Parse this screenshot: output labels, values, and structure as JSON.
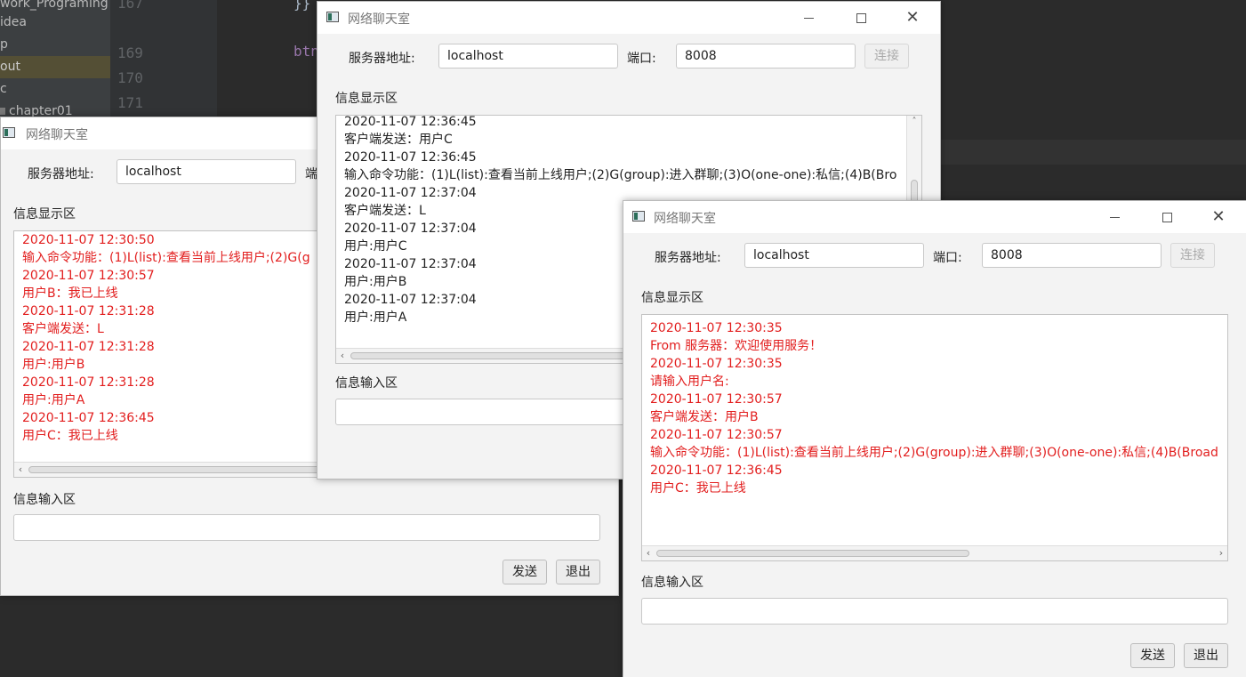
{
  "ide": {
    "tree_items": [
      "work_Programing",
      "idea",
      "p",
      "out",
      "c",
      "chapter01"
    ],
    "line_numbers": [
      "167",
      "169",
      "170",
      "171"
    ],
    "code_fragments": [
      "}}",
      "btn"
    ]
  },
  "win1": {
    "title": "网络聊天室",
    "server_label": "服务器地址:",
    "server_value": "localhost",
    "port_label_partial": "端",
    "log_label": "信息显示区",
    "log_lines": [
      "2020-11-07 12:30:50",
      "输入命令功能：(1)L(list):查看当前上线用户;(2)G(g",
      "2020-11-07 12:30:57",
      "用户B：我已上线",
      "2020-11-07 12:31:28",
      "客户端发送：L",
      "2020-11-07 12:31:28",
      "用户:用户B",
      "2020-11-07 12:31:28",
      "用户:用户A",
      "2020-11-07 12:36:45",
      "用户C：我已上线"
    ],
    "input_label": "信息输入区",
    "input_value": "",
    "send_label": "发送",
    "exit_label": "退出"
  },
  "win2": {
    "title": "网络聊天室",
    "server_label": "服务器地址:",
    "server_value": "localhost",
    "port_label": "端口:",
    "port_value": "8008",
    "connect_label": "连接",
    "log_label": "信息显示区",
    "log_lines": [
      "2020-11-07 12:36:45",
      "客户端发送：用户C",
      "2020-11-07 12:36:45",
      "输入命令功能：(1)L(list):查看当前上线用户;(2)G(group):进入群聊;(3)O(one-one):私信;(4)B(Bro",
      "2020-11-07 12:37:04",
      "客户端发送：L",
      "2020-11-07 12:37:04",
      "用户:用户C",
      "2020-11-07 12:37:04",
      "用户:用户B",
      "2020-11-07 12:37:04",
      "用户:用户A"
    ],
    "input_label": "信息输入区",
    "input_value": ""
  },
  "win3": {
    "title": "网络聊天室",
    "server_label": "服务器地址:",
    "server_value": "localhost",
    "port_label": "端口:",
    "port_value": "8008",
    "connect_label": "连接",
    "log_label": "信息显示区",
    "log_lines": [
      "2020-11-07 12:30:35",
      "From 服务器：欢迎使用服务！",
      "2020-11-07 12:30:35",
      "请输入用户名:",
      "2020-11-07 12:30:57",
      "客户端发送：用户B",
      "2020-11-07 12:30:57",
      "输入命令功能：(1)L(list):查看当前上线用户;(2)G(group):进入群聊;(3)O(one-one):私信;(4)B(Broad",
      "2020-11-07 12:36:45",
      "用户C：我已上线"
    ],
    "input_label": "信息输入区",
    "input_value": "",
    "send_label": "发送",
    "exit_label": "退出"
  },
  "colors": {
    "log_text": "#e21e1e",
    "ide_background": "#2b2b2b"
  }
}
